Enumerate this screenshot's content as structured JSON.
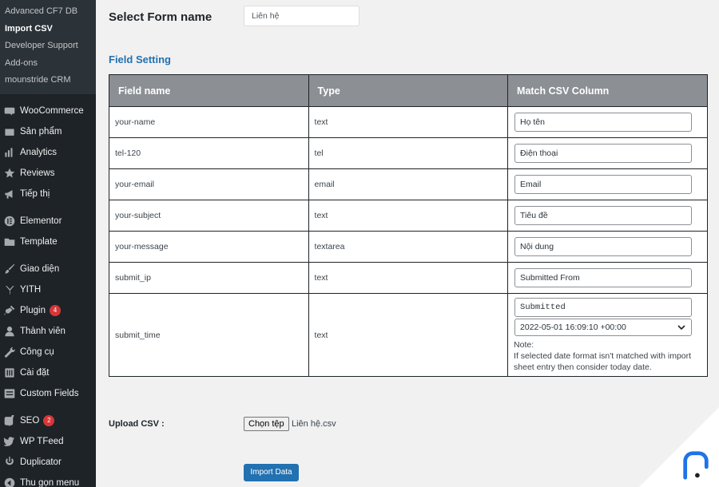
{
  "sidebar": {
    "submenu": [
      {
        "label": "Advanced CF7 DB",
        "current": false
      },
      {
        "label": "Import CSV",
        "current": true
      },
      {
        "label": "Developer Support",
        "current": false
      },
      {
        "label": "Add-ons",
        "current": false
      },
      {
        "label": "mounstride CRM",
        "current": false
      }
    ],
    "groups": [
      [
        {
          "label": "WooCommerce",
          "icon": "woocommerce-icon"
        },
        {
          "label": "Sản phẩm",
          "icon": "products-icon"
        },
        {
          "label": "Analytics",
          "icon": "analytics-icon"
        },
        {
          "label": "Reviews",
          "icon": "star-icon"
        },
        {
          "label": "Tiếp thị",
          "icon": "megaphone-icon"
        }
      ],
      [
        {
          "label": "Elementor",
          "icon": "elementor-icon"
        },
        {
          "label": "Template",
          "icon": "folder-icon"
        }
      ],
      [
        {
          "label": "Giao diện",
          "icon": "paintbrush-icon"
        },
        {
          "label": "YITH",
          "icon": "yith-icon"
        },
        {
          "label": "Plugin",
          "icon": "plugin-icon",
          "badge": "4"
        },
        {
          "label": "Thành viên",
          "icon": "user-icon"
        },
        {
          "label": "Công cụ",
          "icon": "wrench-icon"
        },
        {
          "label": "Cài đặt",
          "icon": "settings-icon"
        },
        {
          "label": "Custom Fields",
          "icon": "custom-fields-icon"
        }
      ],
      [
        {
          "label": "SEO",
          "icon": "yoast-icon",
          "badge": "2"
        },
        {
          "label": "WP TFeed",
          "icon": "twitter-icon"
        },
        {
          "label": "Duplicator",
          "icon": "duplicator-icon"
        },
        {
          "label": "Thu gọn menu",
          "icon": "collapse-icon"
        }
      ]
    ]
  },
  "main": {
    "select_form_label": "Select Form name",
    "form_select_value": "Liên hệ",
    "field_setting_title": "Field Setting",
    "table": {
      "headers": [
        "Field name",
        "Type",
        "Match CSV Column"
      ],
      "rows": [
        {
          "field": "your-name",
          "type": "text",
          "csv": "Họ tên"
        },
        {
          "field": "tel-120",
          "type": "tel",
          "csv": "Điện thoại"
        },
        {
          "field": "your-email",
          "type": "email",
          "csv": "Email"
        },
        {
          "field": "your-subject",
          "type": "text",
          "csv": "Tiêu đề"
        },
        {
          "field": "your-message",
          "type": "textarea",
          "csv": "Nội dung"
        },
        {
          "field": "submit_ip",
          "type": "text",
          "csv": "Submitted From"
        },
        {
          "field": "submit_time",
          "type": "text",
          "csv": "Submitted",
          "date_format": "2022-05-01 16:09:10 +00:00",
          "note_title": "Note:",
          "note_text": "If selected date format isn't matched with import sheet entry then consider today date."
        }
      ]
    },
    "upload_label": "Upload CSV :",
    "file_button_label": "Chọn tệp",
    "file_name": "Liên hệ.csv",
    "import_button_label": "Import Data"
  },
  "colors": {
    "sidebar_bg": "#1d2327",
    "accent": "#2271b1",
    "table_header_bg": "#8c8f94",
    "badge": "#d63638",
    "logo": "#1e73e8"
  }
}
